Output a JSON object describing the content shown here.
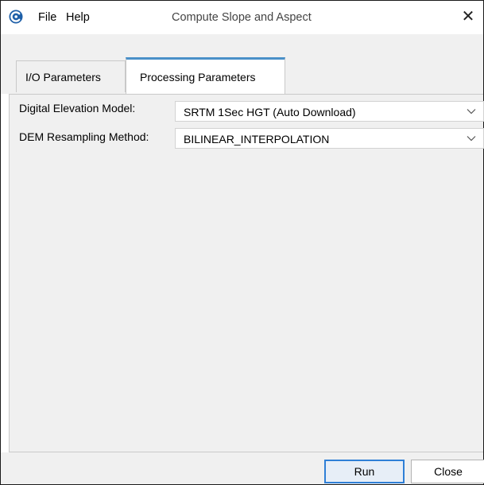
{
  "window": {
    "title": "Compute Slope and Aspect",
    "close_glyph": "✕"
  },
  "menu": {
    "file": "File",
    "help": "Help"
  },
  "tabs": [
    {
      "label": "I/O Parameters",
      "selected": false
    },
    {
      "label": "Processing Parameters",
      "selected": true
    }
  ],
  "fields": {
    "dem": {
      "label": "Digital Elevation Model:",
      "value": "SRTM 1Sec HGT (Auto Download)"
    },
    "resampling": {
      "label": "DEM Resampling Method:",
      "value": "BILINEAR_INTERPOLATION"
    }
  },
  "buttons": {
    "run": "Run",
    "close": "Close"
  },
  "icons": {
    "app": "snap-app-icon",
    "dropdown": "chevron-down-icon"
  },
  "colors": {
    "tab_accent": "#4a90c8",
    "run_button_border": "#2f7fd6",
    "panel_background": "#f0f0f0"
  }
}
